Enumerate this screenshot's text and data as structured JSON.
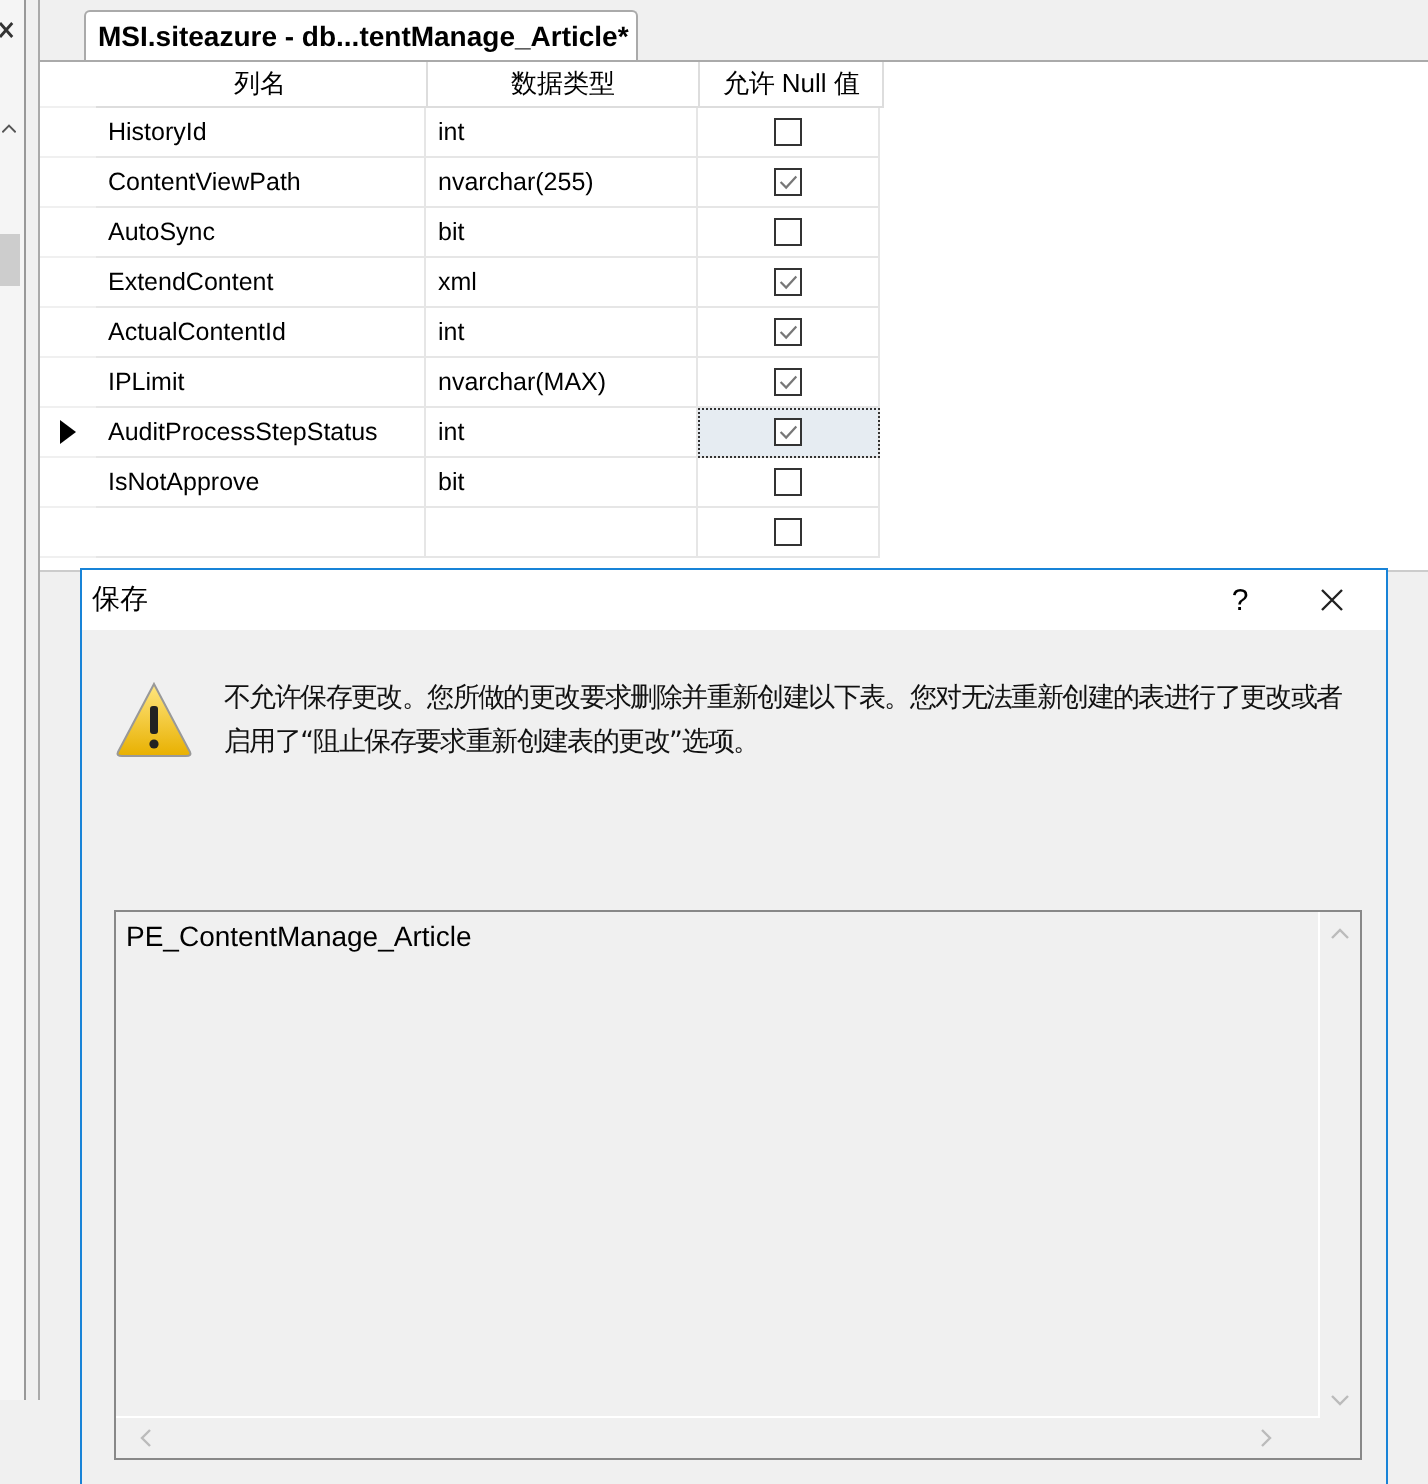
{
  "tab": {
    "title": "MSI.siteazure - db...tentManage_Article*",
    "selected": true
  },
  "grid": {
    "columns": [
      "列名",
      "数据类型",
      "允许 Null 值"
    ],
    "rows": [
      {
        "kind": "column",
        "name": "HistoryId",
        "type": "int",
        "allow_null": false,
        "current": false
      },
      {
        "kind": "column",
        "name": "ContentViewPath",
        "type": "nvarchar(255)",
        "allow_null": true,
        "current": false
      },
      {
        "kind": "column",
        "name": "AutoSync",
        "type": "bit",
        "allow_null": false,
        "current": false
      },
      {
        "kind": "column",
        "name": "ExtendContent",
        "type": "xml",
        "allow_null": true,
        "current": false
      },
      {
        "kind": "column",
        "name": "ActualContentId",
        "type": "int",
        "allow_null": true,
        "current": false
      },
      {
        "kind": "column",
        "name": "IPLimit",
        "type": "nvarchar(MAX)",
        "allow_null": true,
        "current": false
      },
      {
        "kind": "column",
        "name": "AuditProcessStepStatus",
        "type": "int",
        "allow_null": true,
        "current": true
      },
      {
        "kind": "column",
        "name": "IsNotApprove",
        "type": "bit",
        "allow_null": false,
        "current": false
      },
      {
        "kind": "new",
        "allow_null": false,
        "current": false
      }
    ]
  },
  "dialog": {
    "title": "保存",
    "help": "?",
    "message": "不允许保存更改。您所做的更改要求删除并重新创建以下表。您对无法重新创建的表进行了更改或者启用了“阻止保存要求重新创建表的更改”选项。",
    "list_items": [
      "PE_ContentManage_Article"
    ]
  }
}
